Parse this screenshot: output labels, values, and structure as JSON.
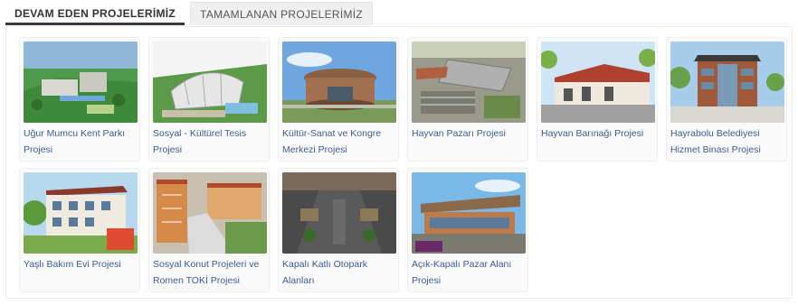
{
  "tabs": [
    {
      "label": "DEVAM EDEN PROJELERİMİZ",
      "active": true
    },
    {
      "label": "TAMAMLANAN PROJELERİMİZ",
      "active": false
    }
  ],
  "projects": [
    {
      "title": "Uğur Mumcu Kent Parkı Projesi"
    },
    {
      "title": "Sosyal - Kültürel Tesis Projesi"
    },
    {
      "title": "Kültür-Sanat ve Kongre Merkezi Projesi"
    },
    {
      "title": "Hayvan Pazarı Projesi"
    },
    {
      "title": "Hayvan Barınağı Projesi"
    },
    {
      "title": "Hayrabolu Belediyesi Hizmet Binası Projesi"
    },
    {
      "title": "Yaşlı Bakım Evi Projesi"
    },
    {
      "title": "Sosyal Konut Projeleri ve Romen TOKİ Projesi"
    },
    {
      "title": "Kapalı Katlı Otopark Alanları"
    },
    {
      "title": "Açık-Kapalı Pazar Alanı Projesi"
    }
  ]
}
